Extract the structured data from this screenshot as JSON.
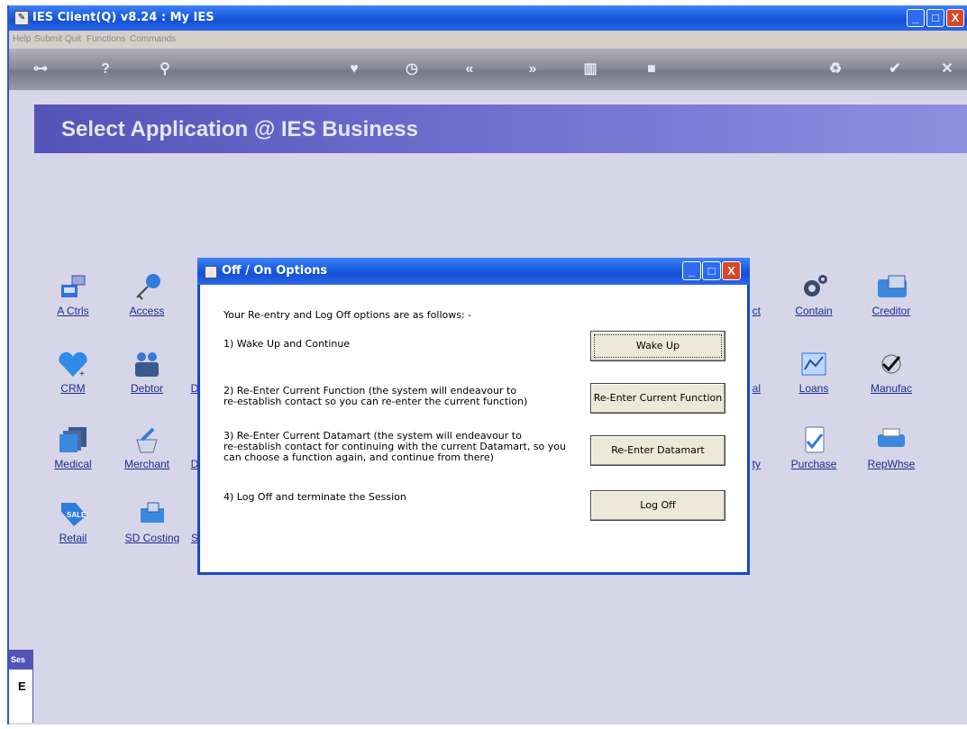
{
  "window": {
    "title": "IES Client(Q) v8.24 : My IES",
    "min_glyph": "_",
    "max_glyph": "□",
    "close_glyph": "X"
  },
  "menu": [
    "Help",
    "Submit",
    "Quit",
    "Functions",
    "Commands"
  ],
  "toolbar_icons": [
    "key-icon",
    "help-icon",
    "search-icon",
    "heart-icon",
    "clock-icon",
    "rewind-icon",
    "forward-icon",
    "trash-icon",
    "stop-icon",
    "recycle-icon",
    "check-icon",
    "cancel-icon"
  ],
  "panel": {
    "title": "Select Application @ IES Business"
  },
  "apps": {
    "row1": [
      "A Ctrls",
      "Access",
      "ct",
      "Contain",
      "Creditor"
    ],
    "row2": [
      "CRM",
      "Debtor",
      "D",
      "al",
      "Loans",
      "Manufac"
    ],
    "row3": [
      "Medical",
      "Merchant",
      "D",
      "ty",
      "Purchase",
      "RepWhse"
    ],
    "row4": [
      "Retail",
      "SD Costing",
      "S"
    ]
  },
  "session": {
    "head": "Ses",
    "value": "E"
  },
  "dialog": {
    "title": "Off / On Options",
    "intro": "Your Re-entry and Log Off options are as follows: -",
    "opt1": "1) Wake Up and Continue",
    "opt2": "2) Re-Enter Current Function (the system will endeavour to\nre-establish contact so you can re-enter the current function)",
    "opt3": "3) Re-Enter Current Datamart (the system will endeavour to\nre-establish contact for continuing with the current Datamart, so you\ncan choose a function again, and continue from there)",
    "opt4": "4) Log Off and terminate the Session",
    "buttons": {
      "wake": "Wake Up",
      "reenter_function": "Re-Enter Current Function",
      "reenter_datamart": "Re-Enter Datamart",
      "logoff": "Log Off"
    }
  }
}
